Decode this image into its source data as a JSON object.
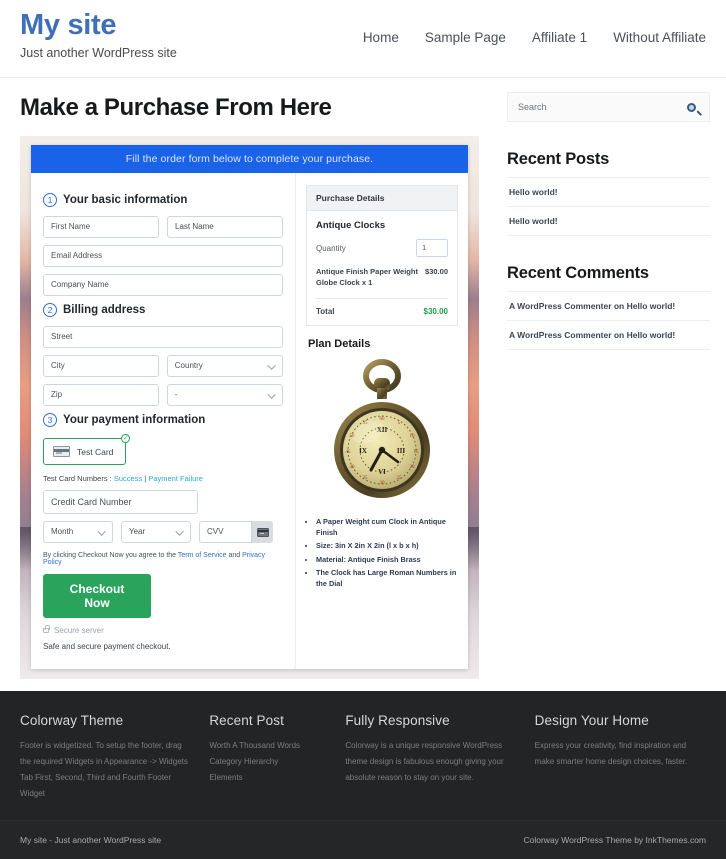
{
  "header": {
    "brand_title": "My site",
    "brand_tagline": "Just another WordPress site",
    "nav": [
      {
        "label": "Home"
      },
      {
        "label": "Sample Page"
      },
      {
        "label": "Affiliate 1"
      },
      {
        "label": "Without Affiliate"
      }
    ]
  },
  "main": {
    "page_title": "Make a Purchase From Here",
    "form": {
      "banner": "Fill the order form below to complete your purchase.",
      "step1": {
        "number": "1",
        "label": "Your basic information",
        "first_name_placeholder": "First Name",
        "last_name_placeholder": "Last Name",
        "email_placeholder": "Email Address",
        "company_placeholder": "Company Name"
      },
      "step2": {
        "number": "2",
        "label": "Billing address",
        "street_placeholder": "Street",
        "city_placeholder": "City",
        "country_placeholder": "Country",
        "zip_placeholder": "Zip",
        "state_placeholder": "-"
      },
      "step3": {
        "number": "3",
        "label": "Your payment information",
        "test_card_label": "Test Card",
        "test_numbers_prefix": "Test Card Numbers : ",
        "test_numbers_success": "Success",
        "test_numbers_separator": " | ",
        "test_numbers_failure": "Payment Failure",
        "card_number_placeholder": "Credit Card Number",
        "month_placeholder": "Month",
        "year_placeholder": "Year",
        "cvv_placeholder": "CVV",
        "terms_prefix": "By clicking Checkout Now you agree to the ",
        "terms_link1": "Term of Service",
        "terms_middle": " and ",
        "terms_link2": "Privacy Policy",
        "checkout_label": "Checkout Now",
        "secure_server": "Secure server",
        "safe_note": "Safe and secure payment checkout."
      }
    },
    "purchase_details": {
      "heading": "Purchase Details",
      "product": "Antique Clocks",
      "quantity_label": "Quantity",
      "quantity_value": "1",
      "line_item_name": "Antique Finish Paper Weight Globe Clock x 1",
      "line_item_price": "$30.00",
      "total_label": "Total",
      "total_value": "$30.00"
    },
    "plan": {
      "title": "Plan Details",
      "bullets": [
        "A Paper Weight cum Clock in Antique Finish",
        "Size: 3in X 2in X 2in (l x b x h)",
        "Material: Antique Finish Brass",
        "The Clock has Large Roman Numbers in the Dial"
      ]
    }
  },
  "sidebar": {
    "search_placeholder": "Search",
    "recent_posts_title": "Recent Posts",
    "recent_posts": [
      {
        "label": "Hello world!"
      },
      {
        "label": "Hello world!"
      }
    ],
    "recent_comments_title": "Recent Comments",
    "recent_comments": [
      {
        "label": "A WordPress Commenter on Hello world!"
      },
      {
        "label": "A WordPress Commenter on Hello world!"
      }
    ]
  },
  "footer": {
    "columns": [
      {
        "title": "Colorway Theme",
        "text": "Footer is widgetized. To setup the footer, drag the required Widgets in Appearance -> Widgets Tab First, Second, Third and Fourth Footer Widget"
      },
      {
        "title": "Recent Post",
        "items": [
          {
            "label": "Worth A Thousand Words"
          },
          {
            "label": "Category Hierarchy"
          },
          {
            "label": "Elements"
          }
        ]
      },
      {
        "title": "Fully Responsive",
        "text": "Colorway is a unique responsive WordPress theme design is fabulous enough giving your absolute reason to stay on your site."
      },
      {
        "title": "Design Your Home",
        "text": "Express your creativity, find inspiration and make smarter home design choices, faster."
      }
    ],
    "copyright_left": "My site - Just another WordPress site",
    "copyright_right": "Colorway WordPress Theme by InkThemes.com"
  },
  "colors": {
    "brand_blue": "#3f6fb5",
    "banner_blue": "#1a62e8",
    "checkout_green": "#2aa35d",
    "total_green": "#1e9e4f",
    "footer_dark": "#222425"
  }
}
